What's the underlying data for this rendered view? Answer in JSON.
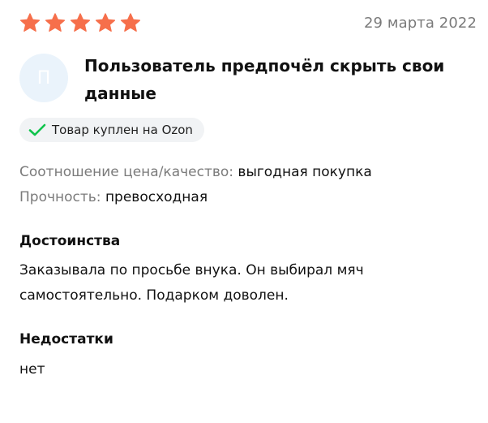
{
  "review": {
    "rating": 5,
    "rating_max": 5,
    "star_color": "#f66f4b",
    "date": "29 марта 2022",
    "author": {
      "avatar_letter": "П",
      "name": "Пользователь предпочёл скрыть свои данные"
    },
    "badge": {
      "icon": "checkmark-icon",
      "icon_color": "#10c44c",
      "text": "Товар куплен на Ozon"
    },
    "attributes": [
      {
        "name": "Соотношение цена/качество:",
        "value": "выгодная покупка"
      },
      {
        "name": "Прочность:",
        "value": "превосходная"
      }
    ],
    "pros": {
      "title": "Достоинства",
      "text": "Заказывала по просьбе внука. Он выбирал мяч самостоятельно. Подарком доволен."
    },
    "cons": {
      "title": "Недостатки",
      "text": "нет"
    }
  }
}
